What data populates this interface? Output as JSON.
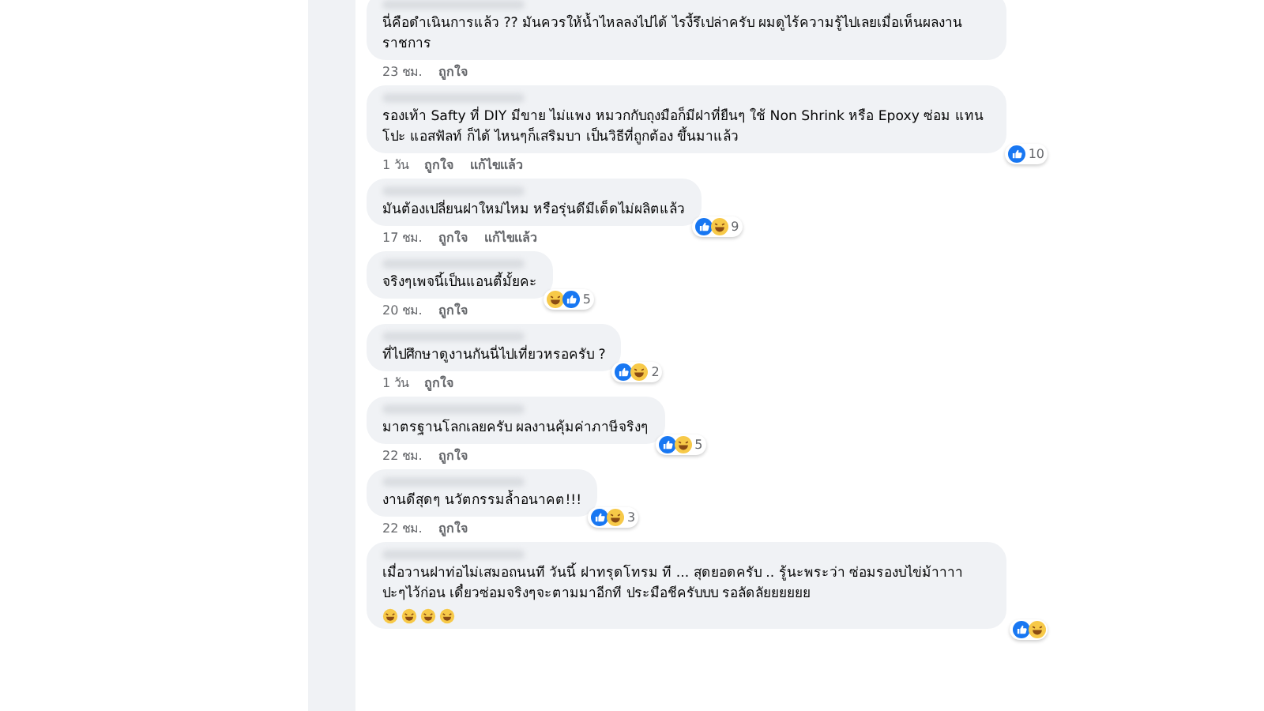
{
  "comments": [
    {
      "text": "นี่คือดำเนินการแล้ว ?? มันควรให้น้ำไหลลงไปได้ ไรงี้รึเปล่าครับ ผมดูไร้ความรู้ไปเลยเมื่อเห็นผลงานราชการ",
      "time": "23 ชม.",
      "actions": [
        "ถูกใจ"
      ]
    },
    {
      "text": "รองเท้า Safty ที่ DIY มีขาย ไม่แพง หมวกกับถุงมือก็มีฝาที่ยืนๆ ใช้ Non Shrink หรือ Epoxy ซ่อม แทนโปะ แอสฟัลท์ ก็ได้ ไหนๆก็เสริมบา เป็นวิธีที่ถูกต้อง ขึ้นมาแล้ว",
      "time": "1 วัน",
      "actions": [
        "ถูกใจ",
        "แก้ไขแล้ว"
      ],
      "reactions": [
        {
          "kind": "like"
        }
      ],
      "count": "10"
    },
    {
      "text": "มันต้องเปลี่ยนฝาใหม่ไหม หรือรุ่นดีมีเด็ดไม่ผลิตแล้ว",
      "time": "17 ชม.",
      "actions": [
        "ถูกใจ",
        "แก้ไขแล้ว"
      ],
      "reactions": [
        {
          "kind": "like"
        },
        {
          "kind": "haha"
        }
      ],
      "count": "9"
    },
    {
      "text": "จริงๆเพจนี้เป็นแอนตี้มั้ยคะ",
      "time": "20 ชม.",
      "actions": [
        "ถูกใจ"
      ],
      "reactions": [
        {
          "kind": "haha"
        },
        {
          "kind": "like"
        }
      ],
      "count": "5"
    },
    {
      "text": "ที่ไปศึกษาดูงานกันนี่ไปเที่ยวหรอครับ ?",
      "time": "1 วัน",
      "actions": [
        "ถูกใจ"
      ],
      "reactions": [
        {
          "kind": "like"
        },
        {
          "kind": "haha"
        }
      ],
      "count": "2"
    },
    {
      "text": "มาตรฐานโลกเลยครับ ผลงานคุ้มค่าภาษีจริงๆ",
      "time": "22 ชม.",
      "actions": [
        "ถูกใจ"
      ],
      "reactions": [
        {
          "kind": "like"
        },
        {
          "kind": "haha"
        }
      ],
      "count": "5"
    },
    {
      "text": "งานดีสุดๆ นวัตกรรมล้ำอนาคต!!!",
      "time": "22 ชม.",
      "actions": [
        "ถูกใจ"
      ],
      "reactions": [
        {
          "kind": "like"
        },
        {
          "kind": "haha"
        }
      ],
      "count": "3"
    },
    {
      "text": "เมื่อวานฝาท่อไม่เสมอถนนที วันนี้ ฝาทรุดโทรม ที ... สุดยอดครับ .. รู้นะพระว่า ซ่อมรองบไข่ม้าาาา ปะๆไว้ก่อน เดี๋ยวซ่อมจริงๆจะตามมาอีกที ประมือชีครับบบ รอลัดลัยยยยยย",
      "emoji": [
        {
          "kind": "laughing"
        },
        {
          "kind": "laughing"
        },
        {
          "kind": "laughing"
        },
        {
          "kind": "laughing"
        }
      ],
      "reactions": [
        {
          "kind": "like"
        },
        {
          "kind": "haha"
        }
      ]
    }
  ]
}
